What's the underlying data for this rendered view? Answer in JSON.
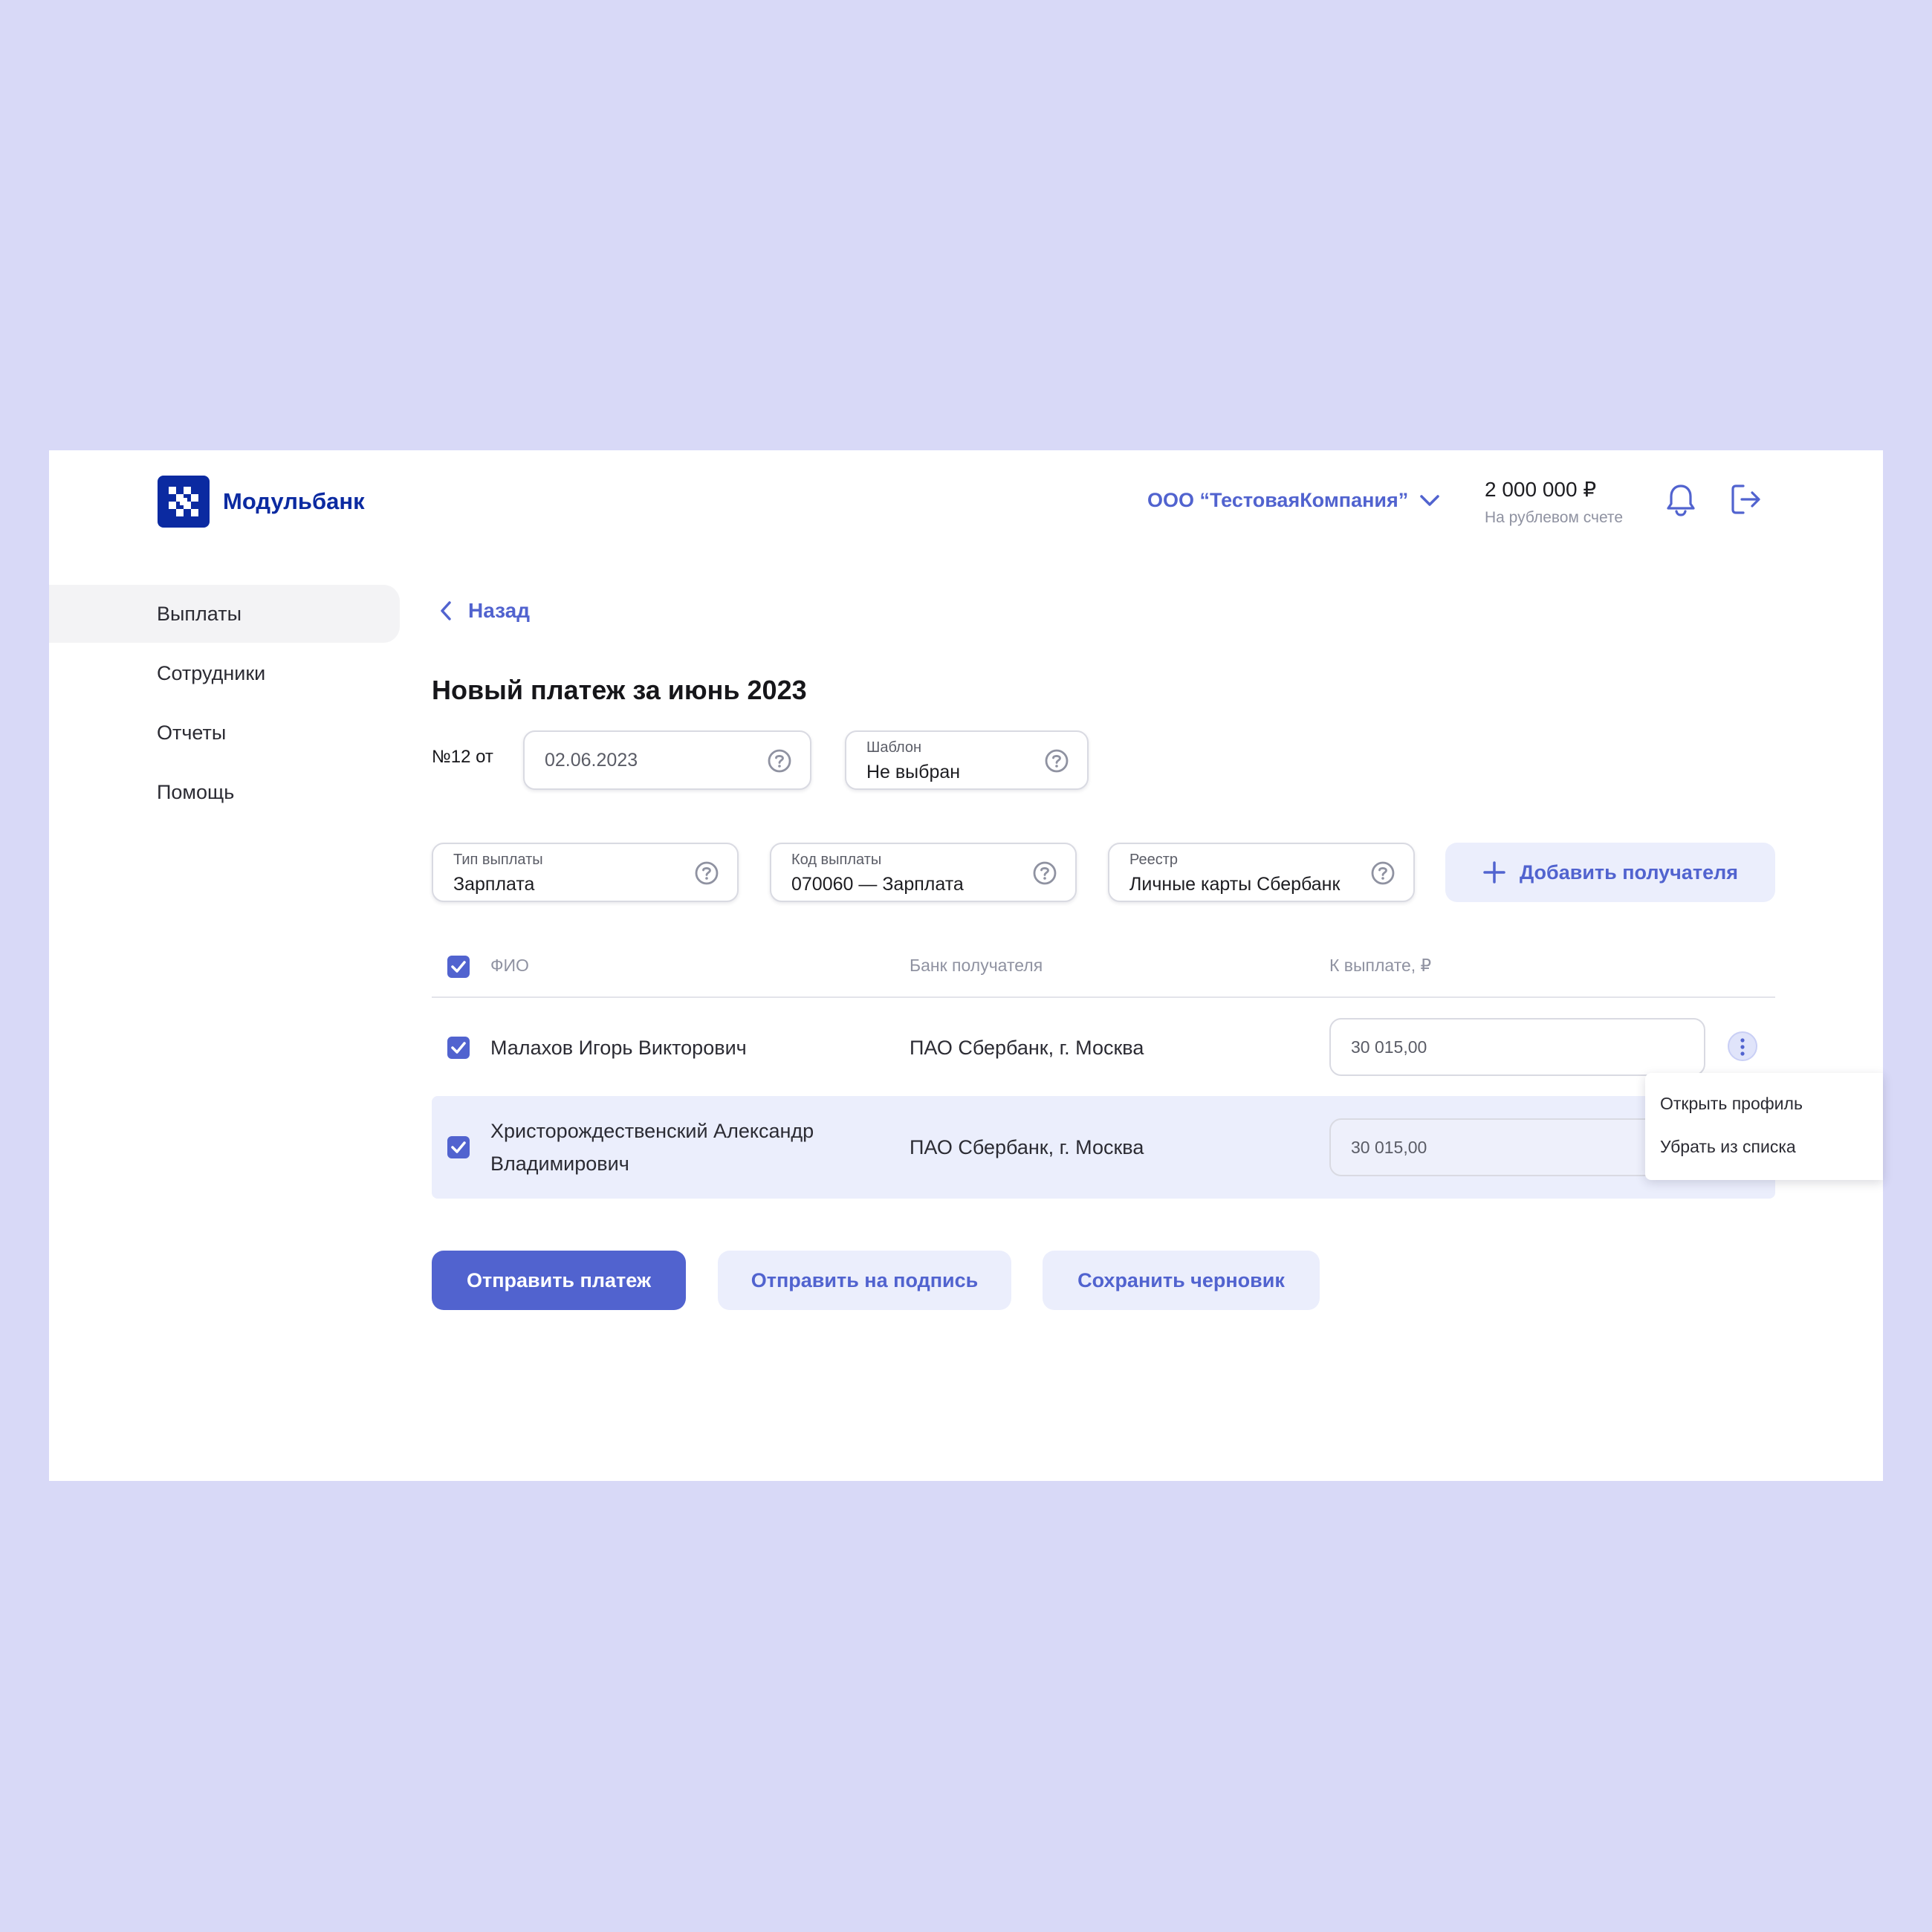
{
  "header": {
    "brand": "Модульбанк",
    "company": "ООО “ТестоваяКомпания”",
    "balance_amount": "2 000 000 ₽",
    "balance_caption": "На рублевом счете"
  },
  "sidebar": {
    "items": [
      {
        "label": "Выплаты",
        "active": true
      },
      {
        "label": "Сотрудники",
        "active": false
      },
      {
        "label": "Отчеты",
        "active": false
      },
      {
        "label": "Помощь",
        "active": false
      }
    ]
  },
  "main": {
    "back_label": "Назад",
    "title": "Новый платеж за июнь 2023",
    "number_label": "№12 от",
    "date_value": "02.06.2023",
    "template": {
      "label": "Шаблон",
      "value": "Не выбран"
    },
    "payment_type": {
      "label": "Тип выплаты",
      "value": "Зарплата"
    },
    "payment_code": {
      "label": "Код выплаты",
      "value": "070060 — Зарплата"
    },
    "registry": {
      "label": "Реестр",
      "value": "Личные карты Сбербанк"
    },
    "add_recipient_label": "Добавить получателя"
  },
  "table": {
    "columns": [
      "ФИО",
      "Банк получателя",
      "К выплате, ₽"
    ],
    "rows": [
      {
        "name": "Малахов Игорь Викторович",
        "bank": "ПАО Сбербанк, г. Москва",
        "amount": "30 015,00",
        "checked": true
      },
      {
        "name_line1": "Христорождественский Александр",
        "name_line2": "Владимирович",
        "bank": "ПАО Сбербанк, г. Москва",
        "amount": "30 015,00",
        "checked": true
      }
    ]
  },
  "context_menu": {
    "items": [
      "Открыть профиль",
      "Убрать из списка"
    ]
  },
  "actions": {
    "send": "Отправить платеж",
    "sign": "Отправить на подпись",
    "draft": "Сохранить черновик"
  },
  "colors": {
    "accent": "#5163cf",
    "brand": "#0b2aa1",
    "background": "#d8d9f7",
    "accent_light": "#ebeefc"
  }
}
